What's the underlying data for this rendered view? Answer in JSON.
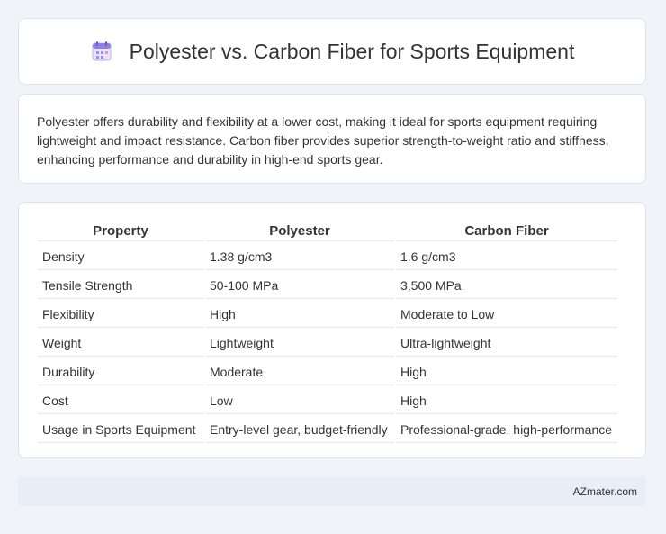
{
  "header": {
    "title": "Polyester vs. Carbon Fiber for Sports Equipment",
    "icon": "calendar-icon"
  },
  "summary": {
    "text": "Polyester offers durability and flexibility at a lower cost, making it ideal for sports equipment requiring lightweight and impact resistance. Carbon fiber provides superior strength-to-weight ratio and stiffness, enhancing performance and durability in high-end sports gear."
  },
  "table": {
    "headers": [
      "Property",
      "Polyester",
      "Carbon Fiber"
    ],
    "rows": [
      [
        "Density",
        "1.38 g/cm3",
        "1.6 g/cm3"
      ],
      [
        "Tensile Strength",
        "50-100 MPa",
        "3,500 MPa"
      ],
      [
        "Flexibility",
        "High",
        "Moderate to Low"
      ],
      [
        "Weight",
        "Lightweight",
        "Ultra-lightweight"
      ],
      [
        "Durability",
        "Moderate",
        "High"
      ],
      [
        "Cost",
        "Low",
        "High"
      ],
      [
        "Usage in Sports Equipment",
        "Entry-level gear, budget-friendly",
        "Professional-grade, high-performance"
      ]
    ]
  },
  "footer": {
    "text": "AZmater.com"
  },
  "colors": {
    "background": "#f0f3f8",
    "card": "#ffffff",
    "footer_bg": "#e8edf7"
  }
}
